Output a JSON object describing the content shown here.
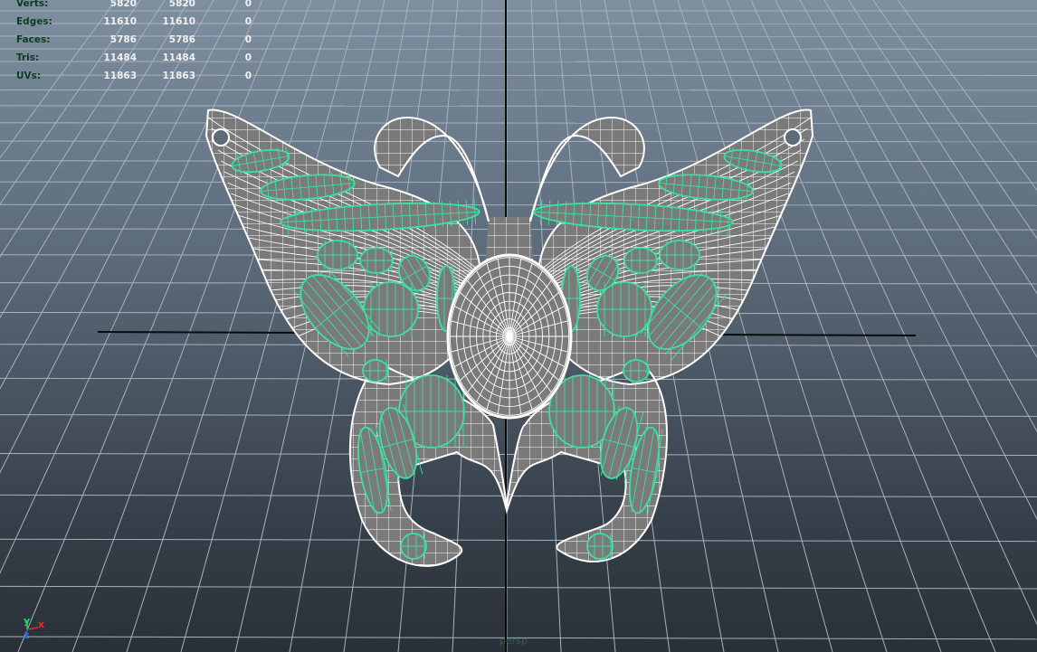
{
  "hud": {
    "rows": [
      {
        "label": "Verts:",
        "v1": "5820",
        "v2": "5820",
        "v3": "0"
      },
      {
        "label": "Edges:",
        "v1": "11610",
        "v2": "11610",
        "v3": "0"
      },
      {
        "label": "Faces:",
        "v1": "5786",
        "v2": "5786",
        "v3": "0"
      },
      {
        "label": "Tris:",
        "v1": "11484",
        "v2": "11484",
        "v3": "0"
      },
      {
        "label": "UVs:",
        "v1": "11863",
        "v2": "11863",
        "v3": "0"
      }
    ]
  },
  "camera": {
    "label": "persp"
  },
  "axis": {
    "x": "x",
    "y": "y",
    "z": "z"
  },
  "colors": {
    "wireframe": "#ffffff",
    "highlight_edges": "#3de0a0",
    "mesh_fill": "#7a7a7a",
    "grid": "#a7b2bd",
    "axis_lines": "#0b0b0b"
  }
}
